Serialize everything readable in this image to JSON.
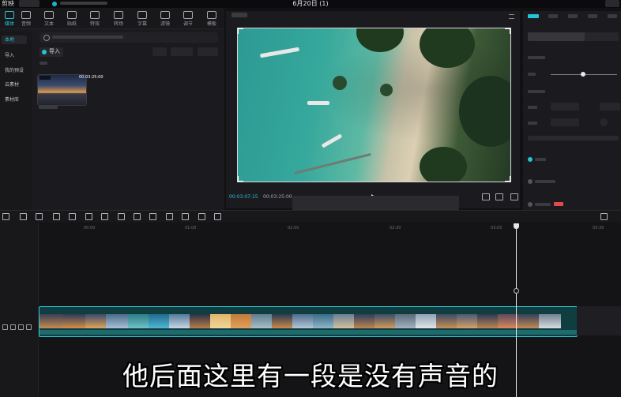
{
  "titlebar": {
    "app_name": "剪映",
    "doc_title": "6月20日 (1)"
  },
  "media": {
    "tabs": [
      {
        "label": "媒体",
        "icon": "media-icon"
      },
      {
        "label": "音频",
        "icon": "audio-icon"
      },
      {
        "label": "文本",
        "icon": "text-icon"
      },
      {
        "label": "贴纸",
        "icon": "sticker-icon"
      },
      {
        "label": "特效",
        "icon": "effect-icon"
      },
      {
        "label": "转场",
        "icon": "transition-icon"
      },
      {
        "label": "字幕",
        "icon": "caption-icon"
      },
      {
        "label": "滤镜",
        "icon": "filter-icon"
      },
      {
        "label": "调节",
        "icon": "adjust-icon"
      },
      {
        "label": "模板",
        "icon": "template-icon"
      }
    ],
    "side_items": [
      "本地",
      "导入",
      "我的预设",
      "云素材",
      "素材库"
    ],
    "import_label": "导入",
    "clip": {
      "duration": "00:03:25:00"
    }
  },
  "player": {
    "time_current": "00:03:07:15",
    "time_total": "00:03:25:00"
  },
  "timeline": {
    "ticks": [
      "00:00",
      "01:00",
      "02:00",
      "02:30",
      "03:00",
      "03:30"
    ]
  },
  "subtitle": "他后面这里有一段是没有声音的",
  "colors": {
    "accent": "#24c4d6",
    "clip_border": "#2cc6d2"
  }
}
